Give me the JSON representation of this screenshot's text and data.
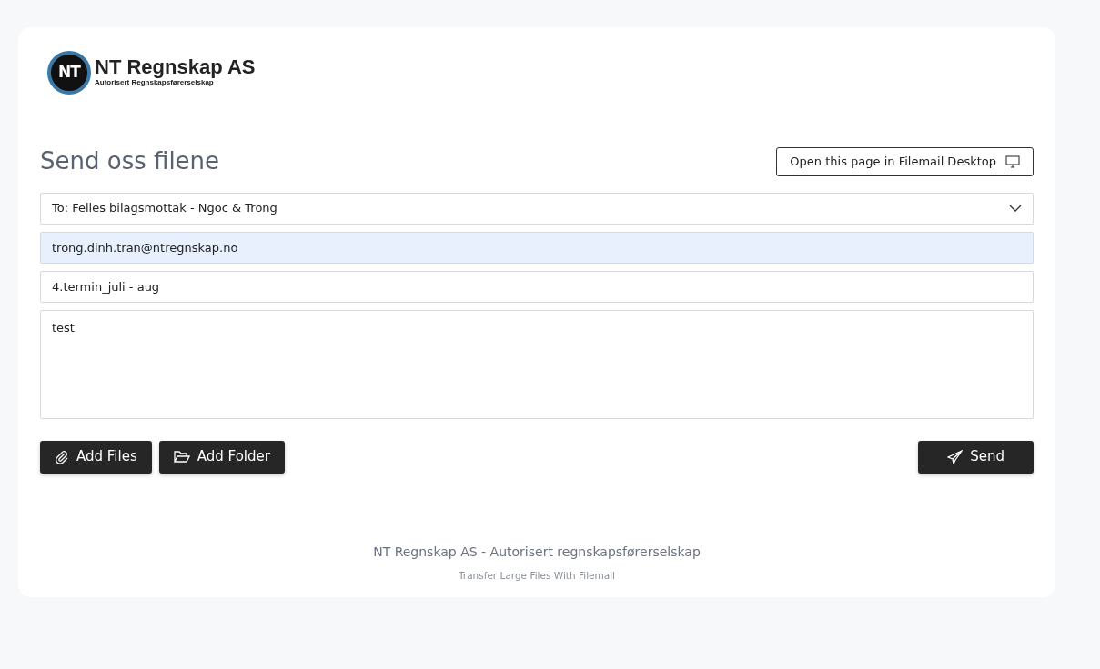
{
  "logo": {
    "badge": "NT",
    "name": "NT Regnskap AS",
    "tagline": "Autorisert Regnskapsførerselskap"
  },
  "title": "Send oss filene",
  "desktop_button": "Open this page in Filemail Desktop",
  "recipient_select": {
    "value": "To: Felles bilagsmottak - Ngoc & Trong"
  },
  "email_field": {
    "value": "trong.dinh.tran@ntregnskap.no",
    "autofilled": true
  },
  "subject_field": {
    "value": "4.termin_juli - aug"
  },
  "message_field": {
    "value": "test"
  },
  "buttons": [
    {
      "label": "Add Files",
      "kind": "files"
    },
    {
      "label": "Add Folder",
      "kind": "folder"
    },
    {
      "label": "Send",
      "kind": "send"
    }
  ],
  "footer": {
    "company": "NT Regnskap AS - Autorisert regnskapsførerselskap",
    "link": "Transfer Large Files With Filemail"
  }
}
